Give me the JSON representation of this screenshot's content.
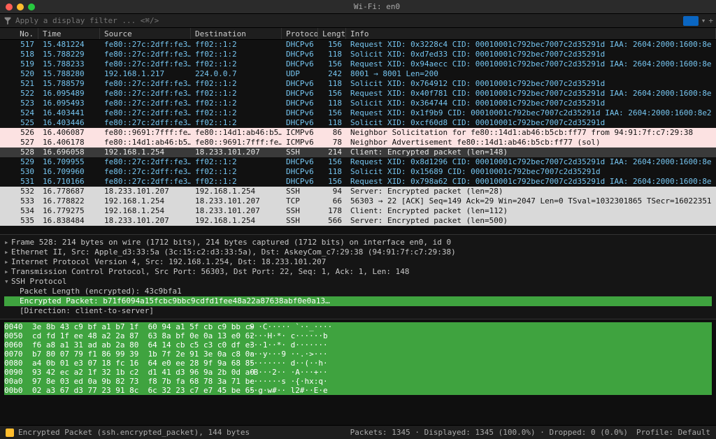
{
  "window": {
    "title": "Wi-Fi: en0"
  },
  "filter": {
    "placeholder": "Apply a display filter ... <⌘/>"
  },
  "columns": {
    "no": "No.",
    "time": "Time",
    "source": "Source",
    "destination": "Destination",
    "protocol": "Protocol",
    "length": "Length",
    "info": "Info"
  },
  "packets": [
    {
      "no": "517",
      "time": "15.481224",
      "src": "fe80::27c:2dff:fe3…",
      "dst": "ff02::1:2",
      "proto": "DHCPv6",
      "len": "156",
      "info": "Request XID: 0x3228c4 CID: 00010001c792bec7007c2d35291d IAA: 2604:2000:1600:8e",
      "cls": "dhcp"
    },
    {
      "no": "518",
      "time": "15.788229",
      "src": "fe80::27c:2dff:fe3…",
      "dst": "ff02::1:2",
      "proto": "DHCPv6",
      "len": "118",
      "info": "Solicit XID: 0xd7ed33 CID: 00010001c792bec7007c2d35291d",
      "cls": "dhcp"
    },
    {
      "no": "519",
      "time": "15.788233",
      "src": "fe80::27c:2dff:fe3…",
      "dst": "ff02::1:2",
      "proto": "DHCPv6",
      "len": "156",
      "info": "Request XID: 0x94aecc CID: 00010001c792bec7007c2d35291d IAA: 2604:2000:1600:8e",
      "cls": "dhcp"
    },
    {
      "no": "520",
      "time": "15.788280",
      "src": "192.168.1.217",
      "dst": "224.0.0.7",
      "proto": "UDP",
      "len": "242",
      "info": "8001 → 8001 Len=200",
      "cls": "udp"
    },
    {
      "no": "521",
      "time": "15.788579",
      "src": "fe80::27c:2dff:fe3…",
      "dst": "ff02::1:2",
      "proto": "DHCPv6",
      "len": "118",
      "info": "Solicit XID: 0x764912 CID: 00010001c792bec7007c2d35291d",
      "cls": "dhcp"
    },
    {
      "no": "522",
      "time": "16.095489",
      "src": "fe80::27c:2dff:fe3…",
      "dst": "ff02::1:2",
      "proto": "DHCPv6",
      "len": "156",
      "info": "Request XID: 0x40f781 CID: 00010001c792bec7007c2d35291d IAA: 2604:2000:1600:8e",
      "cls": "dhcp"
    },
    {
      "no": "523",
      "time": "16.095493",
      "src": "fe80::27c:2dff:fe3…",
      "dst": "ff02::1:2",
      "proto": "DHCPv6",
      "len": "118",
      "info": "Solicit XID: 0x364744 CID: 00010001c792bec7007c2d35291d",
      "cls": "dhcp"
    },
    {
      "no": "524",
      "time": "16.403441",
      "src": "fe80::27c:2dff:fe3…",
      "dst": "ff02::1:2",
      "proto": "DHCPv6",
      "len": "156",
      "info": "Request XID: 0x1f9b9 CID: 00010001c792bec7007c2d35291d IAA: 2604:2000:1600:8e2",
      "cls": "dhcp"
    },
    {
      "no": "525",
      "time": "16.403446",
      "src": "fe80::27c:2dff:fe3…",
      "dst": "ff02::1:2",
      "proto": "DHCPv6",
      "len": "118",
      "info": "Solicit XID: 0xcf60d8 CID: 00010001c792bec7007c2d35291d",
      "cls": "dhcp"
    },
    {
      "no": "526",
      "time": "16.406087",
      "src": "fe80::9691:7fff:fe…",
      "dst": "fe80::14d1:ab46:b5…",
      "proto": "ICMPv6",
      "len": "86",
      "info": "Neighbor Solicitation for fe80::14d1:ab46:b5cb:ff77 from 94:91:7f:c7:29:38",
      "cls": "icmp"
    },
    {
      "no": "527",
      "time": "16.406178",
      "src": "fe80::14d1:ab46:b5…",
      "dst": "fe80::9691:7fff:fe…",
      "proto": "ICMPv6",
      "len": "78",
      "info": "Neighbor Advertisement fe80::14d1:ab46:b5cb:ff77 (sol)",
      "cls": "icmp"
    },
    {
      "no": "528",
      "time": "16.696058",
      "src": "192.168.1.254",
      "dst": "18.233.101.207",
      "proto": "SSH",
      "len": "214",
      "info": "Client: Encrypted packet (len=148)",
      "cls": "ssh",
      "sel": true
    },
    {
      "no": "529",
      "time": "16.709955",
      "src": "fe80::27c:2dff:fe3…",
      "dst": "ff02::1:2",
      "proto": "DHCPv6",
      "len": "156",
      "info": "Request XID: 0x8d1296 CID: 00010001c792bec7007c2d35291d IAA: 2604:2000:1600:8e",
      "cls": "dhcp"
    },
    {
      "no": "530",
      "time": "16.709960",
      "src": "fe80::27c:2dff:fe3…",
      "dst": "ff02::1:2",
      "proto": "DHCPv6",
      "len": "118",
      "info": "Solicit XID: 0x15689 CID: 00010001c792bec7007c2d35291d",
      "cls": "dhcp"
    },
    {
      "no": "531",
      "time": "16.710166",
      "src": "fe80::27c:2dff:fe3…",
      "dst": "ff02::1:2",
      "proto": "DHCPv6",
      "len": "156",
      "info": "Request XID: 0x798a62 CID: 00010001c792bec7007c2d35291d IAA: 2604:2000:1600:8e",
      "cls": "dhcp"
    },
    {
      "no": "532",
      "time": "16.778687",
      "src": "18.233.101.207",
      "dst": "192.168.1.254",
      "proto": "SSH",
      "len": "94",
      "info": "Server: Encrypted packet (len=28)",
      "cls": "ssh"
    },
    {
      "no": "533",
      "time": "16.778822",
      "src": "192.168.1.254",
      "dst": "18.233.101.207",
      "proto": "TCP",
      "len": "66",
      "info": "56303 → 22 [ACK] Seq=149 Ack=29 Win=2047 Len=0 TSval=1032301865 TSecr=16022351",
      "cls": "tcp"
    },
    {
      "no": "534",
      "time": "16.779275",
      "src": "192.168.1.254",
      "dst": "18.233.101.207",
      "proto": "SSH",
      "len": "178",
      "info": "Client: Encrypted packet (len=112)",
      "cls": "ssh"
    },
    {
      "no": "535",
      "time": "16.838484",
      "src": "18.233.101.207",
      "dst": "192.168.1.254",
      "proto": "SSH",
      "len": "566",
      "info": "Server: Encrypted packet (len=500)",
      "cls": "ssh"
    }
  ],
  "details": {
    "l0": "Frame 528: 214 bytes on wire (1712 bits), 214 bytes captured (1712 bits) on interface en0, id 0",
    "l1": "Ethernet II, Src: Apple_d3:33:5a (3c:15:c2:d3:33:5a), Dst: AskeyCom_c7:29:38 (94:91:7f:c7:29:38)",
    "l2": "Internet Protocol Version 4, Src: 192.168.1.254, Dst: 18.233.101.207",
    "l3": "Transmission Control Protocol, Src Port: 56303, Dst Port: 22, Seq: 1, Ack: 1, Len: 148",
    "l4": "SSH Protocol",
    "l5": "Packet Length (encrypted): 43c9bfa1",
    "l6": "Encrypted Packet: b71f6094a15fcbc9bbc9cdfd1fee48a22a87638abf0e0a13…",
    "l7": "[Direction: client-to-server]"
  },
  "hex": [
    {
      "off": "0040",
      "b": "3e 8b 43 c9 bf a1 b7 1f  60 94 a1 5f cb c9 bb c9",
      "a": "> ·C····· `··_····",
      "hl": true
    },
    {
      "off": "0050",
      "b": "cd fd 1f ee 48 a2 2a 87  63 8a bf 0e 0a 13 e0 62",
      "a": "····H·*· c······b",
      "hl": true
    },
    {
      "off": "0060",
      "b": "f6 a8 a1 31 ad ab 2a 80  64 14 cb c5 c3 c0 df e3",
      "a": "···1··*· d·······",
      "hl": true
    },
    {
      "off": "0070",
      "b": "b7 80 07 79 f1 86 99 39  1b 7f 2e 91 3e 0a c8 0a",
      "a": "···y···9 ··.·>···",
      "hl": true
    },
    {
      "off": "0080",
      "b": "a4 0b 01 e3 07 18 fc 16  64 e0 ee 28 9f 9a 68 85",
      "a": "········ d··(··h·",
      "hl": true
    },
    {
      "off": "0090",
      "b": "93 42 ec a2 1f 32 1b c2  d1 41 d3 96 9a 2b 0d a0",
      "a": "·B···2·· ·A···+··",
      "hl": true
    },
    {
      "off": "00a0",
      "b": "97 8e 03 ed 0a 9b 82 73  f8 7b fa 68 78 3a 71 be",
      "a": "·······s ·{·hx:q·",
      "hl": true
    },
    {
      "off": "00b0",
      "b": "02 a3 67 d3 77 23 91 8c  6c 32 23 c7 e7 45 be 65",
      "a": "··g·w#·· l2#··E·e",
      "hl": true
    }
  ],
  "status": {
    "left": "Encrypted Packet (ssh.encrypted_packet), 144 bytes",
    "right": "Packets: 1345 · Displayed: 1345 (100.0%) · Dropped: 0 (0.0%)",
    "profile": "Profile: Default"
  }
}
